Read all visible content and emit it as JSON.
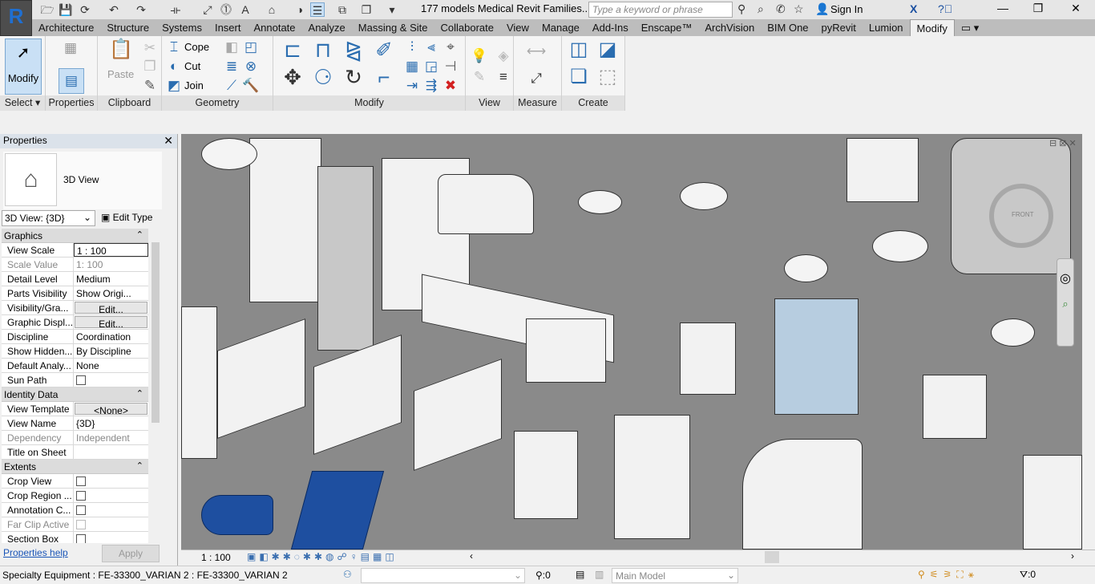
{
  "app": {
    "logo": "R",
    "document_title": "177 models Medical Revit Families...",
    "search_placeholder": "Type a keyword or phrase",
    "sign_in": "Sign In"
  },
  "quick_access_icons": [
    "open-icon",
    "save-icon",
    "sync-icon",
    "undo-icon",
    "redo-icon",
    "measure-icon",
    "dimension-icon",
    "tag-icon",
    "text-icon",
    "3d-view-icon",
    "section-icon",
    "thin-lines-icon",
    "close-views-icon",
    "switch-windows-icon",
    "customize-icon"
  ],
  "tabs": [
    "Architecture",
    "Structure",
    "Systems",
    "Insert",
    "Annotate",
    "Analyze",
    "Massing & Site",
    "Collaborate",
    "View",
    "Manage",
    "Add-Ins",
    "Enscape™",
    "ArchVision",
    "BIM One",
    "pyRevit",
    "Lumion",
    "Modify"
  ],
  "active_tab": "Modify",
  "ribbon": {
    "select": {
      "modify": "Modify",
      "label": "Select ▾"
    },
    "properties": {
      "label": "Properties"
    },
    "clipboard": {
      "paste": "Paste",
      "label": "Clipboard"
    },
    "geometry": {
      "cope": "Cope",
      "cut": "Cut",
      "join": "Join",
      "label": "Geometry"
    },
    "modify": {
      "label": "Modify"
    },
    "view": {
      "label": "View"
    },
    "measure": {
      "label": "Measure"
    },
    "create": {
      "label": "Create"
    }
  },
  "properties": {
    "title": "Properties",
    "type_name": "3D View",
    "type_selector": "3D View: {3D}",
    "edit_type": "Edit Type",
    "groups": [
      {
        "name": "Graphics",
        "rows": [
          {
            "k": "View Scale",
            "v": "1 : 100"
          },
          {
            "k": "Scale Value",
            "v": "1:  100",
            "disabled": true
          },
          {
            "k": "Detail Level",
            "v": "Medium"
          },
          {
            "k": "Parts Visibility",
            "v": "Show Origi..."
          },
          {
            "k": "Visibility/Gra...",
            "v": "Edit...",
            "button": true
          },
          {
            "k": "Graphic Displ...",
            "v": "Edit...",
            "button": true
          },
          {
            "k": "Discipline",
            "v": "Coordination"
          },
          {
            "k": "Show Hidden...",
            "v": "By Discipline"
          },
          {
            "k": "Default Analy...",
            "v": "None"
          },
          {
            "k": "Sun Path",
            "v": "",
            "checkbox": true
          }
        ]
      },
      {
        "name": "Identity Data",
        "rows": [
          {
            "k": "View Template",
            "v": "<None>",
            "button": true
          },
          {
            "k": "View Name",
            "v": "{3D}"
          },
          {
            "k": "Dependency",
            "v": "Independent",
            "disabled": true
          },
          {
            "k": "Title on Sheet",
            "v": ""
          }
        ]
      },
      {
        "name": "Extents",
        "rows": [
          {
            "k": "Crop View",
            "v": "",
            "checkbox": true
          },
          {
            "k": "Crop Region ...",
            "v": "",
            "checkbox": true
          },
          {
            "k": "Annotation C...",
            "v": "",
            "checkbox": true
          },
          {
            "k": "Far Clip Active",
            "v": "",
            "checkbox": true,
            "disabled": true
          },
          {
            "k": "Section Box",
            "v": "",
            "checkbox": true
          }
        ]
      }
    ],
    "help": "Properties help",
    "apply": "Apply"
  },
  "view_control": {
    "scale": "1 : 100"
  },
  "status": {
    "selection": "Specialty Equipment : FE-33300_VARIAN  2 : FE-33300_VARIAN  2",
    "worksets": ":0",
    "model": "Main Model",
    "filter_count": ":0"
  },
  "viewcube": {
    "face": "FRONT"
  }
}
